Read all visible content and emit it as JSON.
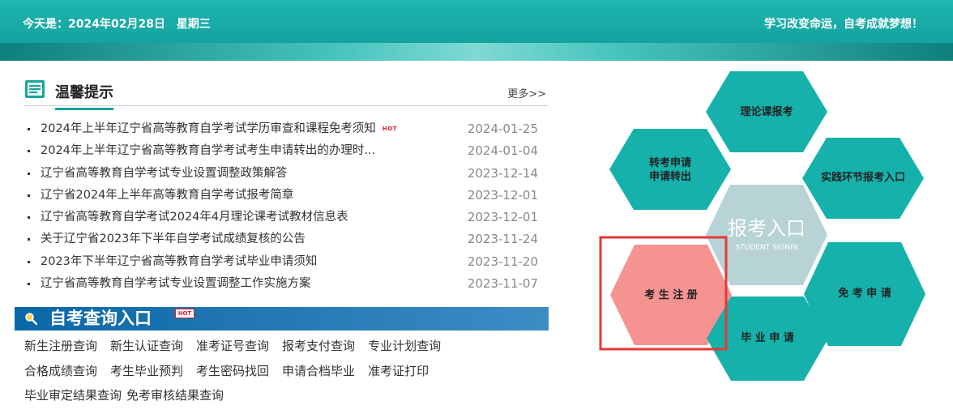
{
  "header": {
    "date_text": "今天是：2024年02月28日　星期三",
    "slogan": "学习改变命运，自考成就梦想！"
  },
  "tips": {
    "title": "温馨提示",
    "more": "更多>>",
    "items": [
      {
        "title": "2024年上半年辽宁省高等教育自学考试学历审查和课程免考须知",
        "hot": "HOT",
        "date": "2024-01-25"
      },
      {
        "title": "2024年上半年辽宁省高等教育自学考试考生申请转出的办理时...",
        "date": "2024-01-04"
      },
      {
        "title": "辽宁省高等教育自学考试专业设置调整政策解答",
        "date": "2023-12-14"
      },
      {
        "title": "辽宁省2024年上半年高等教育自学考试报考简章",
        "date": "2023-12-01"
      },
      {
        "title": "辽宁省高等教育自学考试2024年4月理论课考试教材信息表",
        "date": "2023-12-01"
      },
      {
        "title": "关于辽宁省2023年下半年自学考试成绩复核的公告",
        "date": "2023-11-24"
      },
      {
        "title": "2023年下半年辽宁省高等教育自学考试毕业申请须知",
        "date": "2023-11-20"
      },
      {
        "title": "辽宁省高等教育自学考试专业设置调整工作实施方案",
        "date": "2023-11-07"
      }
    ]
  },
  "query": {
    "title": "自考查询入口",
    "hot": "HOT",
    "row1": [
      "新生注册查询",
      "新生认证查询",
      "准考证号查询",
      "报考支付查询",
      "专业计划查询"
    ],
    "row2": [
      "合格成绩查询",
      "考生毕业预判",
      "考生密码找回",
      "申请合档毕业",
      "准考证打印"
    ],
    "row3": [
      "毕业审定结果查询",
      "免考审核结果查询"
    ]
  },
  "hexes": {
    "top": "理论课报考",
    "transfer_line1": "转考申请",
    "transfer_line2": "申请转出",
    "practice": "实践环节报考入口",
    "center_title": "报考入口",
    "center_sub": "STUDENT SIGNIN",
    "register": "考 生 注 册",
    "exempt": "免 考 申 请",
    "graduate": "毕 业 申 请"
  },
  "colors": {
    "teal": "#16b1ab",
    "center": "#b7d3d6",
    "highlight": "#f59391",
    "outline": "#e53935"
  }
}
